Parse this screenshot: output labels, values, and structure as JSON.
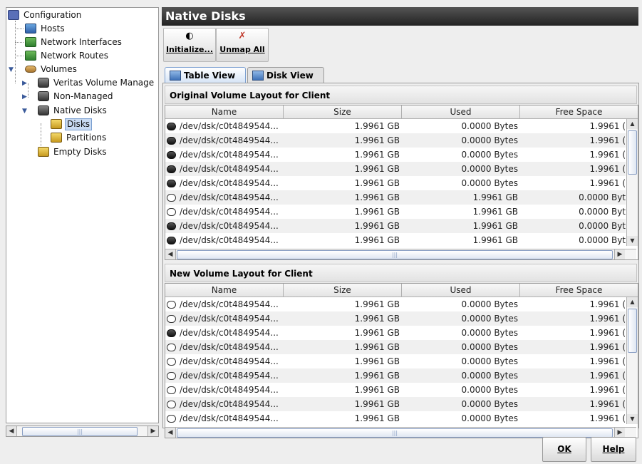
{
  "tree": {
    "items": [
      {
        "label": "Configuration"
      },
      {
        "label": "Hosts"
      },
      {
        "label": "Network Interfaces"
      },
      {
        "label": "Network Routes"
      },
      {
        "label": "Volumes"
      },
      {
        "label": "Veritas Volume Manage"
      },
      {
        "label": "Non-Managed"
      },
      {
        "label": "Native Disks"
      },
      {
        "label": "Disks"
      },
      {
        "label": "Partitions"
      },
      {
        "label": "Empty Disks"
      }
    ],
    "scroll_thumb_label": "|||"
  },
  "header": {
    "title": "Native Disks"
  },
  "toolbar": {
    "initialize_label": "Initialize...",
    "unmap_label": "Unmap All"
  },
  "tabs": [
    {
      "label": "Table View"
    },
    {
      "label": "Disk View"
    }
  ],
  "original": {
    "title": "Original Volume Layout for Client",
    "columns": [
      "Name",
      "Size",
      "Used",
      "Free Space"
    ],
    "rows": [
      {
        "icon": "disk-filled-icon",
        "name": "/dev/dsk/c0t4849544...",
        "size": "1.9961 GB",
        "used": "0.0000 Bytes",
        "free": "1.9961 ("
      },
      {
        "icon": "disk-filled-icon",
        "name": "/dev/dsk/c0t4849544...",
        "size": "1.9961 GB",
        "used": "0.0000 Bytes",
        "free": "1.9961 ("
      },
      {
        "icon": "disk-filled-icon",
        "name": "/dev/dsk/c0t4849544...",
        "size": "1.9961 GB",
        "used": "0.0000 Bytes",
        "free": "1.9961 ("
      },
      {
        "icon": "disk-filled-icon",
        "name": "/dev/dsk/c0t4849544...",
        "size": "1.9961 GB",
        "used": "0.0000 Bytes",
        "free": "1.9961 ("
      },
      {
        "icon": "disk-filled-icon",
        "name": "/dev/dsk/c0t4849544...",
        "size": "1.9961 GB",
        "used": "0.0000 Bytes",
        "free": "1.9961 ("
      },
      {
        "icon": "disk-empty-icon",
        "name": "/dev/dsk/c0t4849544...",
        "size": "1.9961 GB",
        "used": "1.9961 GB",
        "free": "0.0000 Byt"
      },
      {
        "icon": "disk-empty-icon",
        "name": "/dev/dsk/c0t4849544...",
        "size": "1.9961 GB",
        "used": "1.9961 GB",
        "free": "0.0000 Byt"
      },
      {
        "icon": "disk-filled-icon",
        "name": "/dev/dsk/c0t4849544...",
        "size": "1.9961 GB",
        "used": "1.9961 GB",
        "free": "0.0000 Byt"
      },
      {
        "icon": "disk-filled-icon",
        "name": "/dev/dsk/c0t4849544...",
        "size": "1.9961 GB",
        "used": "1.9961 GB",
        "free": "0.0000 Byt"
      }
    ]
  },
  "new": {
    "title": "New Volume Layout for Client",
    "columns": [
      "Name",
      "Size",
      "Used",
      "Free Space"
    ],
    "rows": [
      {
        "icon": "disk-empty-icon",
        "name": "/dev/dsk/c0t4849544...",
        "size": "1.9961 GB",
        "used": "0.0000 Bytes",
        "free": "1.9961 ("
      },
      {
        "icon": "disk-empty-icon",
        "name": "/dev/dsk/c0t4849544...",
        "size": "1.9961 GB",
        "used": "0.0000 Bytes",
        "free": "1.9961 ("
      },
      {
        "icon": "disk-filled-icon",
        "name": "/dev/dsk/c0t4849544...",
        "size": "1.9961 GB",
        "used": "0.0000 Bytes",
        "free": "1.9961 ("
      },
      {
        "icon": "disk-empty-icon",
        "name": "/dev/dsk/c0t4849544...",
        "size": "1.9961 GB",
        "used": "0.0000 Bytes",
        "free": "1.9961 ("
      },
      {
        "icon": "disk-empty-icon",
        "name": "/dev/dsk/c0t4849544...",
        "size": "1.9961 GB",
        "used": "0.0000 Bytes",
        "free": "1.9961 ("
      },
      {
        "icon": "disk-empty-icon",
        "name": "/dev/dsk/c0t4849544...",
        "size": "1.9961 GB",
        "used": "0.0000 Bytes",
        "free": "1.9961 ("
      },
      {
        "icon": "disk-empty-icon",
        "name": "/dev/dsk/c0t4849544...",
        "size": "1.9961 GB",
        "used": "0.0000 Bytes",
        "free": "1.9961 ("
      },
      {
        "icon": "disk-empty-icon",
        "name": "/dev/dsk/c0t4849544...",
        "size": "1.9961 GB",
        "used": "0.0000 Bytes",
        "free": "1.9961 ("
      },
      {
        "icon": "disk-empty-icon",
        "name": "/dev/dsk/c0t4849544...",
        "size": "1.9961 GB",
        "used": "0.0000 Bytes",
        "free": "1.9961 ("
      }
    ]
  },
  "footer": {
    "ok_label": "OK",
    "help_label": "Help"
  }
}
